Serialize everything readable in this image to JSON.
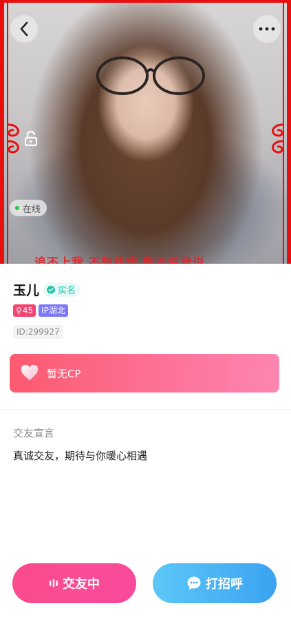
{
  "hero": {
    "online_label": "在线",
    "caption_text": "追不上我 不想找我 就不说我说"
  },
  "profile": {
    "name": "玉儿",
    "verify_label": "实名",
    "gender_symbol": "♀",
    "age": "45",
    "ip_label": "IP湖北",
    "id_label": "ID:299927"
  },
  "cp": {
    "label": "暂无CP"
  },
  "declaration": {
    "title": "交友宣言",
    "text": "真诚交友，期待与你暖心相遇"
  },
  "actions": {
    "friend_label": "交友中",
    "greet_label": "打招呼"
  },
  "colors": {
    "frame_red": "#e80f0f",
    "verify_teal": "#1fbfa7",
    "gender_pink": "#f2456f",
    "ip_purple": "#7d79f6",
    "cp_gradient_start": "#fc5a6f",
    "cp_gradient_end": "#fd86b0",
    "friend_button": "#fb4b8e",
    "greet_button": "#3aa3f2"
  },
  "icons": {
    "back": "chevron-left-icon",
    "more": "more-horizontal-icon",
    "lock": "lock-icon",
    "verify": "verified-check-icon",
    "heart": "heart-icon",
    "wave": "audio-wave-icon",
    "chat": "chat-bubble-icon"
  }
}
